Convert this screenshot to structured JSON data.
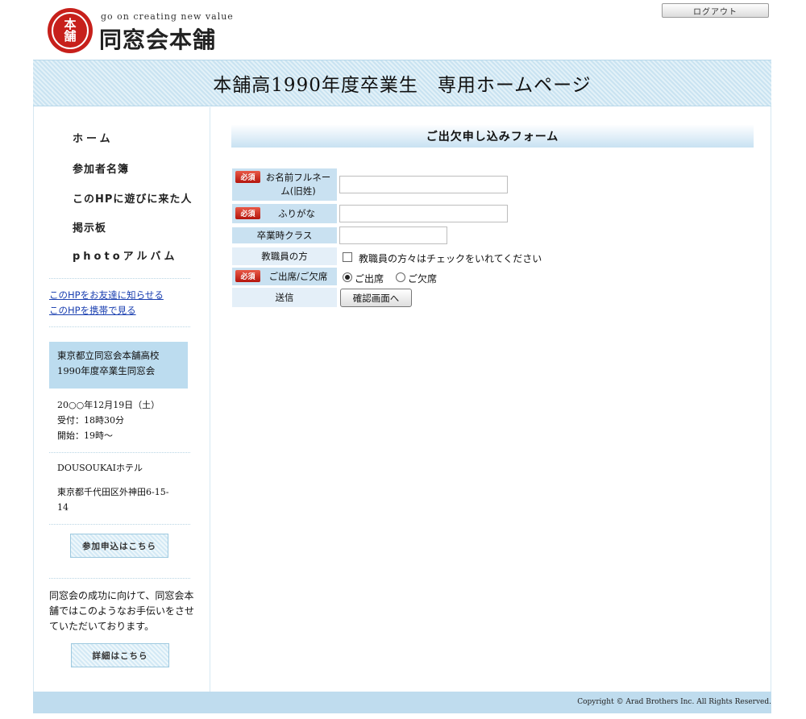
{
  "header": {
    "logo_seal_line1": "本",
    "logo_seal_line2": "舗",
    "tagline": "go on creating new value",
    "logo_name": "同窓会本舗",
    "logout_label": "ログアウト"
  },
  "banner": {
    "title": "本舗高1990年度卒業生　専用ホームページ"
  },
  "sidebar": {
    "nav": [
      {
        "label": "ホーム"
      },
      {
        "label": "参加者名簿"
      },
      {
        "label": "このHPに遊びに来た人"
      },
      {
        "label": "掲示板"
      },
      {
        "label": "photoアルバム"
      }
    ],
    "links": [
      {
        "label": "このHPをお友達に知らせる"
      },
      {
        "label": "このHPを携帯で見る"
      }
    ],
    "event_box": {
      "line1": "東京都立同窓会本舗高校",
      "line2": "1990年度卒業生同窓会"
    },
    "schedule": {
      "date": "20○○年12月19日（土）",
      "reception": "受付：18時30分",
      "start": "開始：19時～"
    },
    "venue": {
      "name": "DOUSOUKAIホテル",
      "address_line1": "東京都千代田区外神田6-15-",
      "address_line2": "14"
    },
    "apply_button": "参加申込はこちら",
    "promo_text": "同窓会の成功に向けて、同窓会本舗ではこのようなお手伝いをさせていただいております。",
    "details_button": "詳細はこちら"
  },
  "form": {
    "title": "ご出欠申し込みフォーム",
    "required_badge": "必須",
    "fields": {
      "name_label_line1": "お名前フルネー",
      "name_label_line2": "ム(旧姓)",
      "name_value": "",
      "furigana_label": "ふりがな",
      "furigana_value": "",
      "class_label": "卒業時クラス",
      "class_value": "",
      "staff_label": "教職員の方",
      "staff_checkbox_text": "教職員の方々はチェックをいれてください",
      "attendance_label": "ご出席/ご欠席",
      "attend_option": "ご出席",
      "absent_option": "ご欠席",
      "submit_label": "送信"
    },
    "confirm_button": "確認画面へ"
  },
  "footer": {
    "copyright": "Copyright © Arad Brothers Inc. All Rights Reserved."
  }
}
